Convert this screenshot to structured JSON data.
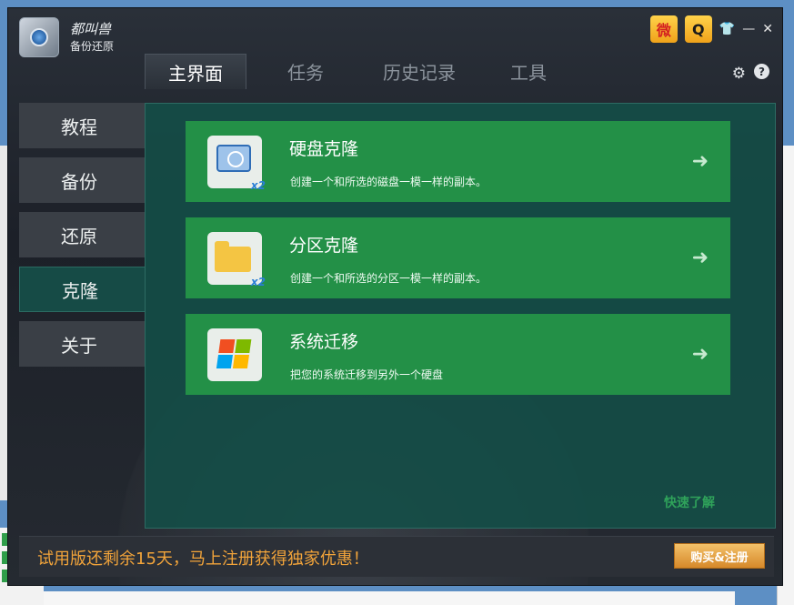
{
  "app": {
    "brand_script": "都叫兽",
    "name": "备份还原"
  },
  "tabs": [
    {
      "label": "主界面",
      "active": true
    },
    {
      "label": "任务",
      "active": false
    },
    {
      "label": "历史记录",
      "active": false
    },
    {
      "label": "工具",
      "active": false
    }
  ],
  "sidebar": {
    "items": [
      {
        "label": "教程",
        "active": false
      },
      {
        "label": "备份",
        "active": false
      },
      {
        "label": "还原",
        "active": false
      },
      {
        "label": "克隆",
        "active": true
      },
      {
        "label": "关于",
        "active": false
      }
    ]
  },
  "cards": [
    {
      "title": "硬盘克隆",
      "desc": "创建一个和所选的磁盘一模一样的副本。",
      "badge": "x2",
      "icon": "disk-clone-icon"
    },
    {
      "title": "分区克隆",
      "desc": "创建一个和所选的分区一模一样的副本。",
      "badge": "x2",
      "icon": "partition-clone-icon"
    },
    {
      "title": "系统迁移",
      "desc": "把您的系统迁移到另外一个硬盘",
      "icon": "windows-logo-icon"
    }
  ],
  "quick_link": "快速了解",
  "footer": {
    "promo": "试用版还剩余15天，马上注册获得独家优惠！",
    "buy_label": "购买&注册"
  },
  "icons": {
    "weibo": "微",
    "qq": "Q",
    "settings": "⚙",
    "help": "?",
    "minimize": "—",
    "close": "✕",
    "arrow": "➜"
  },
  "colors": {
    "card_green": "#239047",
    "panel_teal": "#134f48",
    "promo_orange": "#f2a43a"
  }
}
